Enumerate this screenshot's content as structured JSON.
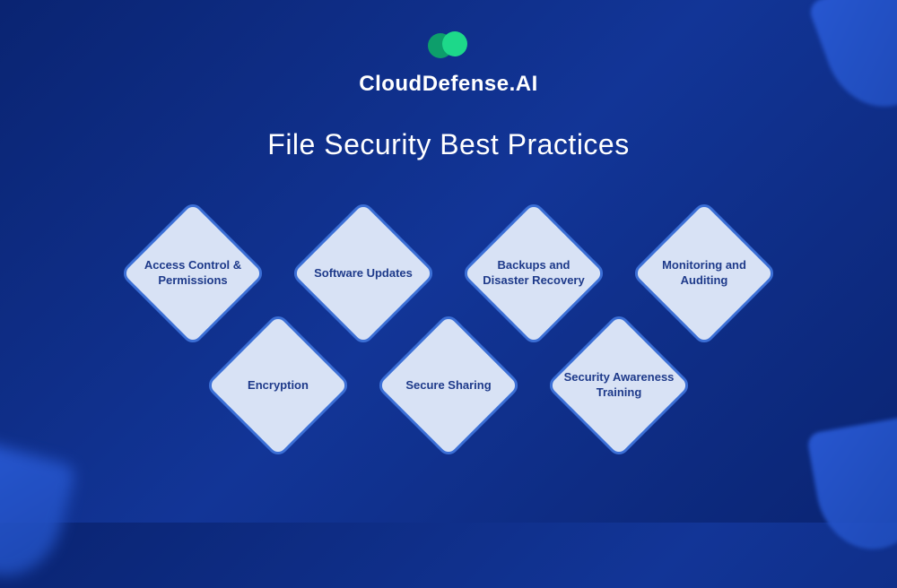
{
  "brand": "CloudDefense.AI",
  "title": "File Security Best Practices",
  "practices": {
    "row1": [
      "Access Control & Permissions",
      "Software Updates",
      "Backups and Disaster Recovery",
      "Monitoring and Auditing"
    ],
    "row2": [
      "Encryption",
      "Secure Sharing",
      "Security Awareness Training"
    ]
  }
}
